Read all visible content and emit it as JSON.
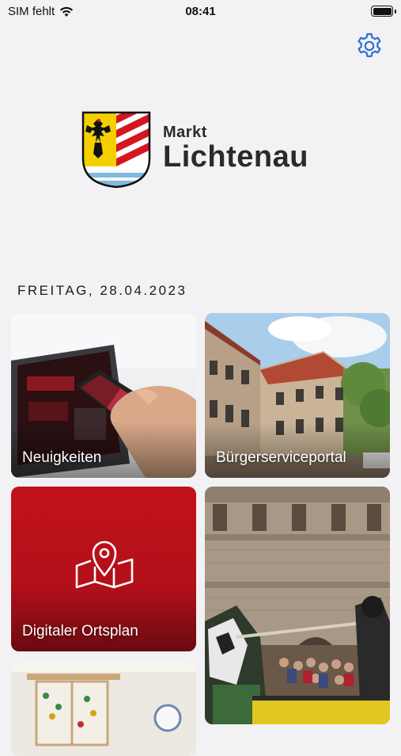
{
  "status": {
    "carrier": "SIM fehlt",
    "time": "08:41"
  },
  "header": {
    "settings_icon": "gear-icon"
  },
  "logo": {
    "line1": "Markt",
    "line2": "Lichtenau"
  },
  "date": "FREITAG, 28.04.2023",
  "tiles": [
    {
      "label": "Neuigkeiten"
    },
    {
      "label": "Bürgerserviceportal"
    },
    {
      "label": "Digitaler Ortsplan",
      "icon": "map-pin-icon"
    },
    {
      "label": ""
    },
    {
      "label": ""
    }
  ],
  "colors": {
    "accent": "#2f6fd6",
    "map_tile": "#c0121b"
  }
}
